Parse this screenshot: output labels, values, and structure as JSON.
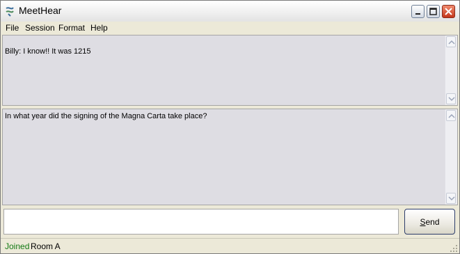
{
  "window": {
    "title": "MeetHear",
    "icon": "app-icon",
    "controls": [
      "minimize-icon",
      "maximize-icon",
      "close-icon"
    ]
  },
  "menu": {
    "items": [
      "File",
      "Session",
      "Format",
      "Help"
    ]
  },
  "chat_log": {
    "text": "Billy: I know!!  It was 1215"
  },
  "question_pane": {
    "text": "In what year did the signing of the Magna Carta take place?"
  },
  "compose": {
    "value": "",
    "send_label": "Send",
    "send_mnemonic": "S"
  },
  "status": {
    "state": "Joined",
    "room": "Room A",
    "state_color": "#147a14"
  }
}
